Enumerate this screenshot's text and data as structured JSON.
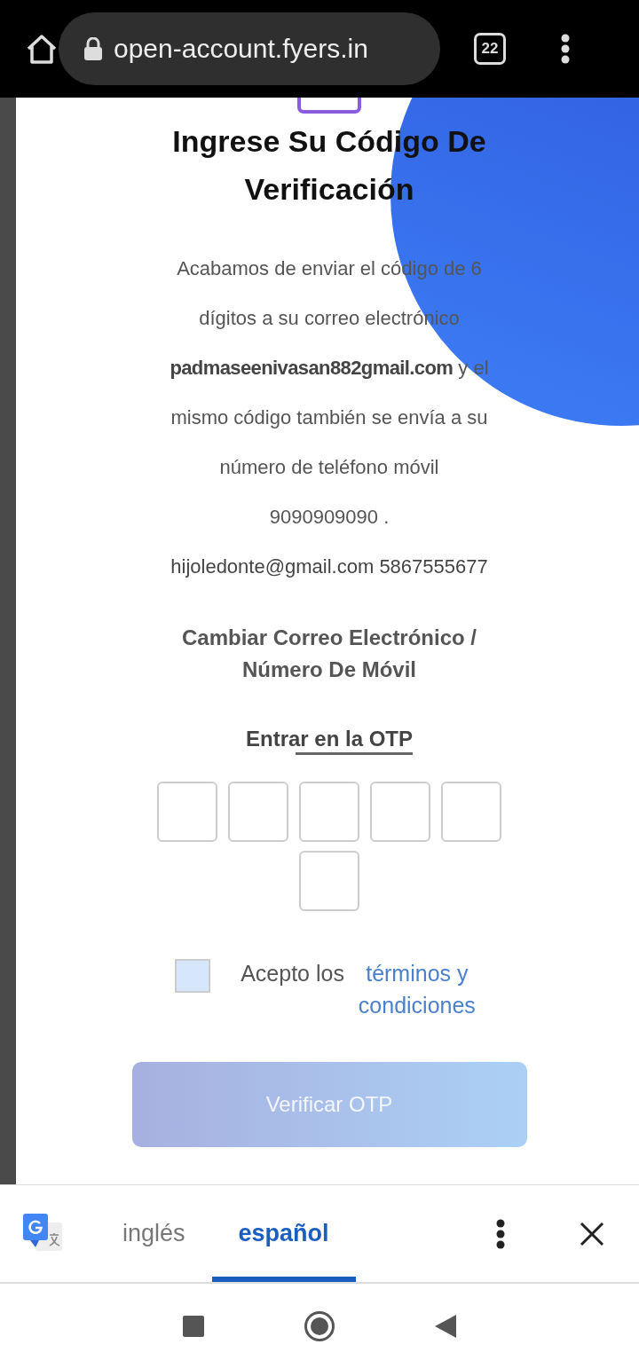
{
  "browser": {
    "url": "open-account.fyers.in",
    "tab_count": "22"
  },
  "page": {
    "title": "Ingrese Su Código De Verificación",
    "message": "Acabamos de enviar el código de 6 dígitos a su correo electrónico **padmaseenivasan882gmail.com** y el mismo código también se envía a su número de teléfono móvil 9090909090 .",
    "contact": "hijoledonte@gmail.com 5867555677",
    "change_link": "Cambiar Correo Electrónico / Número De Móvil",
    "otp_label": "Entrar en la OTP",
    "otp_fields": [
      {
        "kind": "digit"
      },
      {
        "kind": "digit"
      },
      {
        "kind": "digit"
      },
      {
        "kind": "digit"
      },
      {
        "kind": "digit"
      },
      {
        "kind": "digit"
      }
    ],
    "terms": {
      "checked": false,
      "text": "Acepto los",
      "link": "términos y condiciones"
    },
    "verify_button": {
      "label": "Verificar OTP",
      "disabled": true
    }
  },
  "translate_bar": {
    "tabs": [
      {
        "label": "inglés",
        "selected": false
      },
      {
        "label": "español",
        "selected": true
      }
    ]
  }
}
